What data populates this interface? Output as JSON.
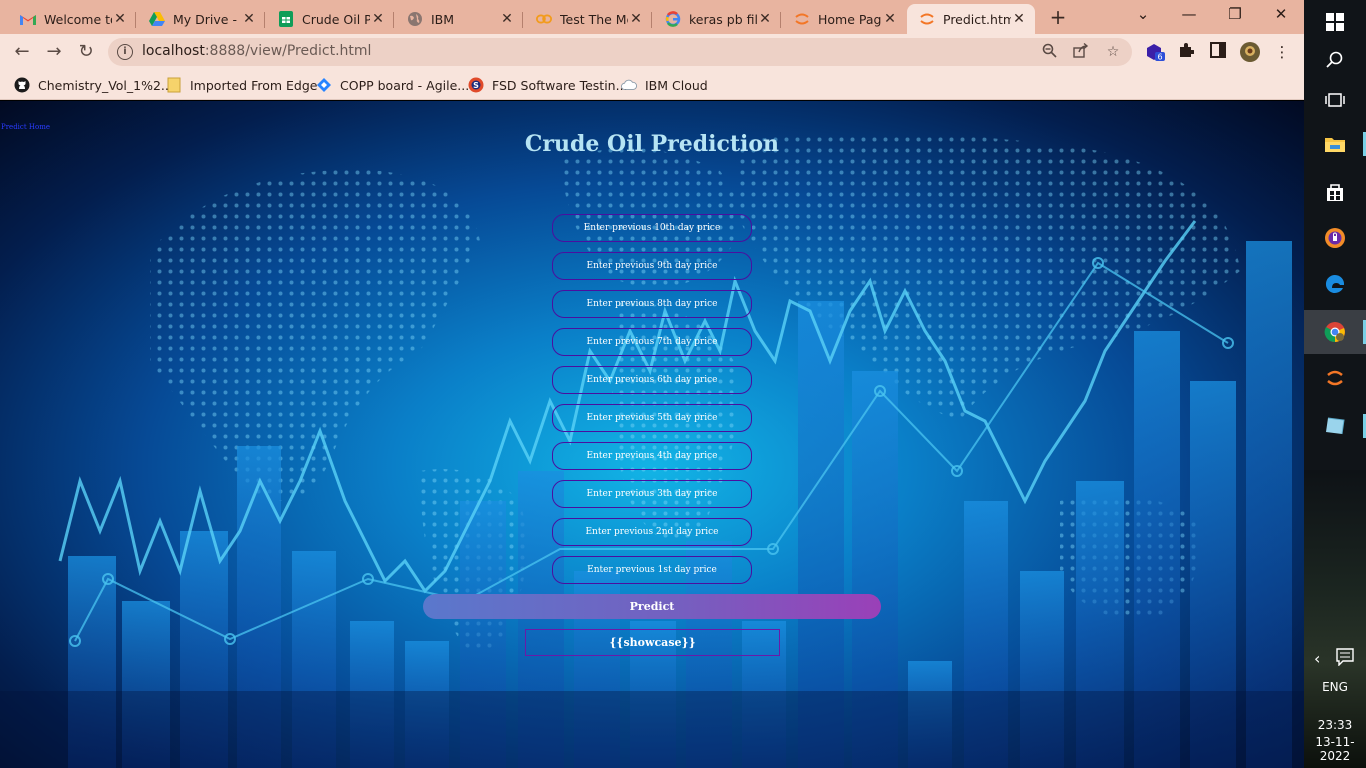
{
  "browser": {
    "tabs": [
      {
        "title": "Welcome to",
        "icon": "gmail-icon"
      },
      {
        "title": "My Drive - G",
        "icon": "google-drive-icon"
      },
      {
        "title": "Crude Oil Pr",
        "icon": "google-sheets-icon"
      },
      {
        "title": "IBM",
        "icon": "globe-icon"
      },
      {
        "title": "Test The Mo",
        "icon": "link-icon"
      },
      {
        "title": "keras pb file",
        "icon": "google-icon"
      },
      {
        "title": "Home Page",
        "icon": "jupyter-icon"
      },
      {
        "title": "Predict.html",
        "icon": "jupyter-icon"
      }
    ],
    "active_tab_index": 7,
    "url_host": "localhost",
    "url_rest": ":8888/view/Predict.html",
    "extension_badge": "6",
    "bookmarks": [
      {
        "label": "Chemistry_Vol_1%2...",
        "icon": "github-icon"
      },
      {
        "label": "Imported From Edge",
        "icon": "folder-icon"
      },
      {
        "label": "COPP board - Agile...",
        "icon": "diamond-icon"
      },
      {
        "label": "FSD Software Testin...",
        "icon": "s-logo-icon"
      },
      {
        "label": "IBM Cloud",
        "icon": "cloud-icon"
      }
    ]
  },
  "page": {
    "home_link": "Predict Home",
    "title": "Crude Oil Prediction",
    "fields": [
      "Enter previous 10th day price",
      "Enter previous 9th day price",
      "Enter previous 8th day price",
      "Enter previous 7th day price",
      "Enter previous 6th day price",
      "Enter previous 5th day price",
      "Enter previous 4th day price",
      "Enter previous 3th day price",
      "Enter previous 2nd day price",
      "Enter previous 1st day price"
    ],
    "predict_label": "Predict",
    "showcase": "{{showcase}}"
  },
  "taskbar": {
    "language": "ENG",
    "time": "23:33",
    "date": "13-11-2022"
  },
  "colors": {
    "tab_bar": "#e8b4a0",
    "toolbar": "#f8e4dc",
    "title_text": "#b6e4f4",
    "field_border": "#4a0fa0",
    "predict_gradient_start": "#5a78cc",
    "predict_gradient_end": "#9a40b8"
  }
}
